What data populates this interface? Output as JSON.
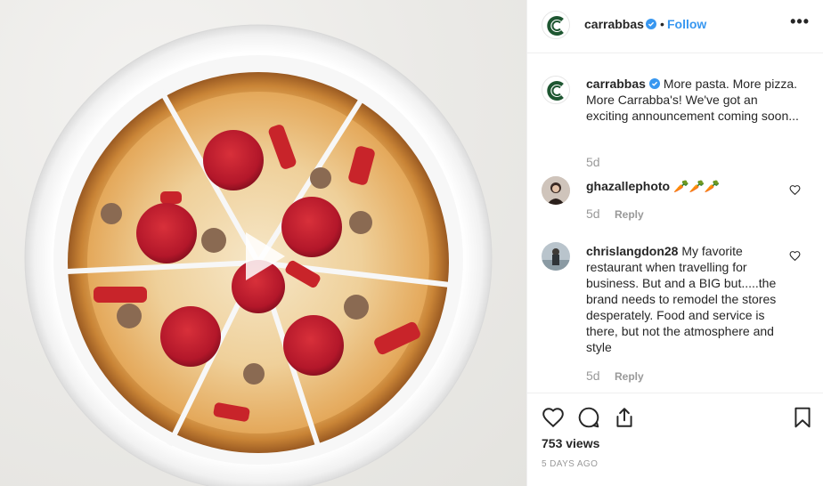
{
  "post": {
    "username": "carrabbas",
    "follow_label": "Follow",
    "separator": "•",
    "more_label": "•••",
    "caption": "More pasta. More pizza. More Carrabba's! We've got an exciting announcement coming soon...",
    "caption_time": "5d"
  },
  "comments": [
    {
      "username": "ghazallephoto",
      "text": "🥕🥕🥕",
      "time": "5d",
      "reply_label": "Reply"
    },
    {
      "username": "chrislangdon28",
      "text": "My favorite restaurant when travelling for business. But and a BIG but.....the brand needs to remodel the stores desperately. Food and service is there, but not the atmosphere and style",
      "time": "5d",
      "reply_label": "Reply"
    }
  ],
  "footer": {
    "views": "753 views",
    "date": "5 DAYS AGO"
  },
  "icons": {
    "like": "heart-icon",
    "comment": "comment-icon",
    "share": "share-icon",
    "save": "bookmark-icon",
    "play": "play-icon",
    "verified": "verified-badge-icon"
  },
  "colors": {
    "brand": "#1e5631",
    "link": "#3897f0",
    "verified": "#3897f0",
    "muted": "#999999"
  }
}
